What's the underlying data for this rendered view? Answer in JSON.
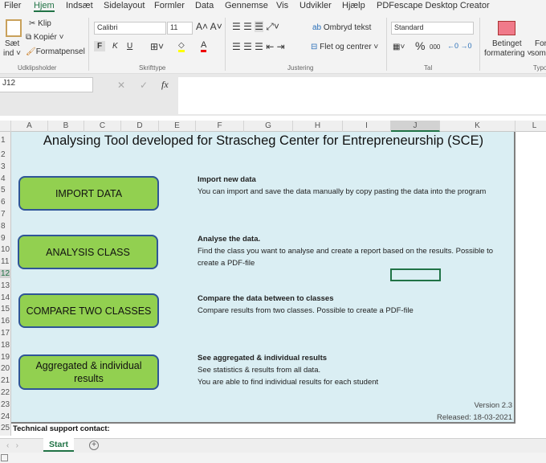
{
  "menu": [
    "Filer",
    "Hjem",
    "Indsæt",
    "Sidelayout",
    "Formler",
    "Data",
    "Gennemse",
    "Vis",
    "Udvikler",
    "Hjælp",
    "PDFescape Desktop Creator"
  ],
  "ribbon": {
    "paste": "Sæt",
    "paste2": "ind ˅",
    "cut": "Klip",
    "copy": "Kopiér",
    "format_painter": "Formatpensel",
    "clipboard": "Udklipsholder",
    "font": "Calibri",
    "size": "11",
    "bold": "F",
    "italic": "K",
    "underline": "U",
    "font_group": "Skrifttype",
    "wrap": "Ombryd tekst",
    "merge": "Flet og centrer",
    "align_group": "Justering",
    "number_format": "Standard",
    "percent": "%",
    "thousands": "000",
    "number_group": "Tal",
    "cond1": "Betinget",
    "cond2": "formatering ˅",
    "fmt1": "For",
    "fmt2": "som",
    "styles_group": "Typo"
  },
  "formula_bar": {
    "name_box": "J12",
    "fx": "fx",
    "value": ""
  },
  "columns": [
    "A",
    "B",
    "C",
    "D",
    "E",
    "F",
    "G",
    "H",
    "I",
    "J",
    "K",
    "L"
  ],
  "rows": [
    "1",
    "2",
    "3",
    "4",
    "5",
    "6",
    "7",
    "8",
    "9",
    "10",
    "11",
    "12",
    "13",
    "14",
    "15",
    "16",
    "17",
    "18",
    "19",
    "20",
    "21",
    "22",
    "23",
    "24",
    "25"
  ],
  "sheet": {
    "title": "Analysing Tool developed for Strascheg Center for Entrepreneurship (SCE)",
    "buttons": [
      "IMPORT DATA",
      "ANALYSIS CLASS",
      "COMPARE TWO CLASSES",
      "Aggregated & individual results"
    ],
    "sections": [
      {
        "heading": "Import new data",
        "lines": [
          "You can import and save the data manually by copy pasting the data into the program"
        ]
      },
      {
        "heading": "Analyse the data.",
        "lines": [
          "Find the class you want to analyse and create a report based on the results. Possible to",
          "create a PDF-file"
        ]
      },
      {
        "heading": "Compare the data between to classes",
        "lines": [
          "Compare results from two classes. Possible to create a PDF-file"
        ]
      },
      {
        "heading": "See aggregated & individual results",
        "lines": [
          "See statistics & results from all data.",
          "You are able to find individual results for each student"
        ]
      }
    ],
    "version": "Version 2.3",
    "released": "Released: 18-03-2021",
    "support": "Technical support contact:"
  },
  "tabs": {
    "active": "Start",
    "add": "+"
  },
  "colors": {
    "panel": "#daeef3",
    "button": "#92d050",
    "button_border": "#2f5597",
    "accent": "#217346"
  }
}
